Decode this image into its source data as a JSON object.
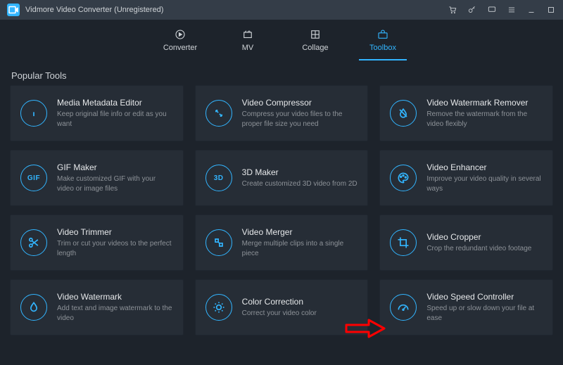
{
  "window": {
    "title": "Vidmore Video Converter (Unregistered)"
  },
  "tabs": {
    "converter": "Converter",
    "mv": "MV",
    "collage": "Collage",
    "toolbox": "Toolbox"
  },
  "section": {
    "popular_tools": "Popular Tools"
  },
  "tools": [
    {
      "title": "Media Metadata Editor",
      "desc": "Keep original file info or edit as you want"
    },
    {
      "title": "Video Compressor",
      "desc": "Compress your video files to the proper file size you need"
    },
    {
      "title": "Video Watermark Remover",
      "desc": "Remove the watermark from the video flexibly"
    },
    {
      "title": "GIF Maker",
      "desc": "Make customized GIF with your video or image files"
    },
    {
      "title": "3D Maker",
      "desc": "Create customized 3D video from 2D"
    },
    {
      "title": "Video Enhancer",
      "desc": "Improve your video quality in several ways"
    },
    {
      "title": "Video Trimmer",
      "desc": "Trim or cut your videos to the perfect length"
    },
    {
      "title": "Video Merger",
      "desc": "Merge multiple clips into a single piece"
    },
    {
      "title": "Video Cropper",
      "desc": "Crop the redundant video footage"
    },
    {
      "title": "Video Watermark",
      "desc": "Add text and image watermark to the video"
    },
    {
      "title": "Color Correction",
      "desc": "Correct your video color"
    },
    {
      "title": "Video Speed Controller",
      "desc": "Speed up or slow down your file at ease"
    }
  ],
  "gif_label": "GIF",
  "three_d_label": "3D"
}
